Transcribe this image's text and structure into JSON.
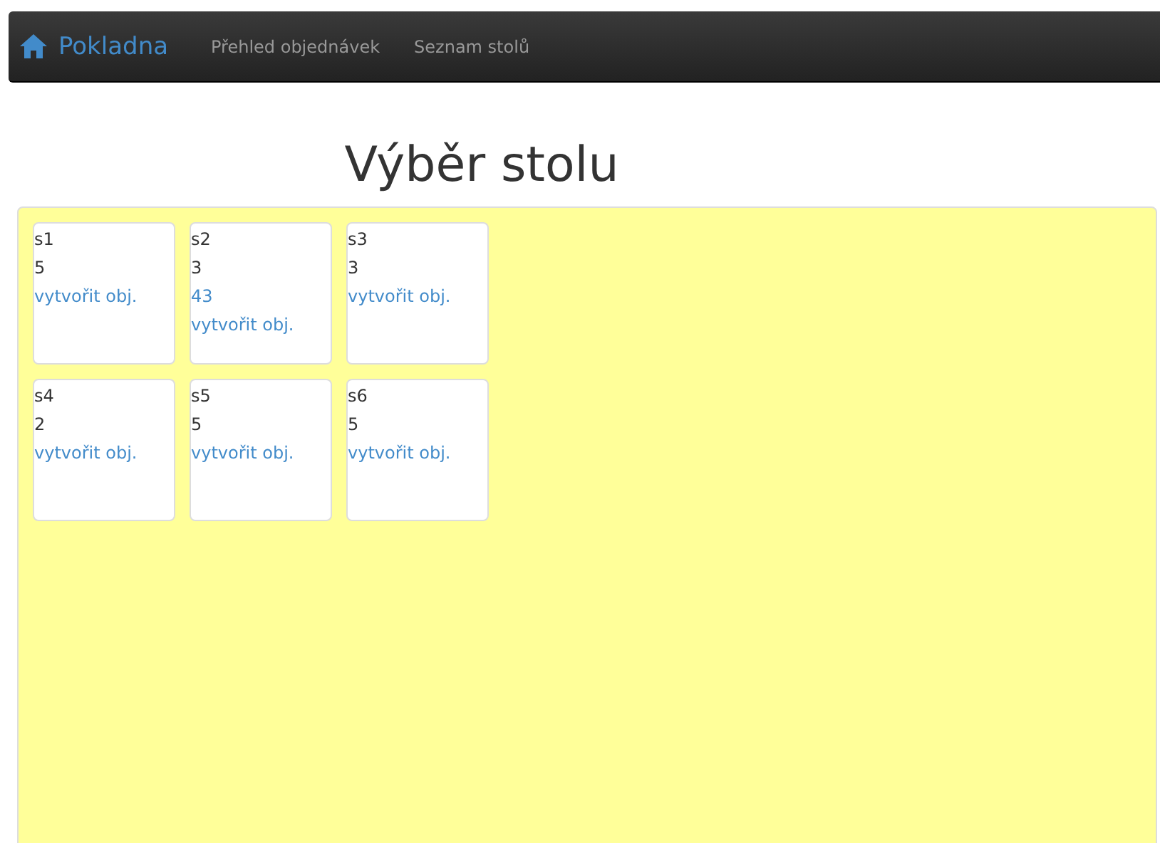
{
  "navbar": {
    "brand": "Pokladna",
    "links": [
      "Přehled objednávek",
      "Seznam stolů"
    ]
  },
  "heading": "Výběr stolu",
  "tables": [
    {
      "name": "s1",
      "seats": "5",
      "create_link": "vytvořit obj."
    },
    {
      "name": "s2",
      "seats": "3",
      "orders": [
        "43"
      ],
      "create_link": "vytvořit obj."
    },
    {
      "name": "s3",
      "seats": "3",
      "create_link": "vytvořit obj."
    },
    {
      "name": "s4",
      "seats": "2",
      "create_link": "vytvořit obj."
    },
    {
      "name": "s5",
      "seats": "5",
      "create_link": "vytvořit obj."
    },
    {
      "name": "s6",
      "seats": "5",
      "create_link": "vytvořit obj."
    }
  ]
}
